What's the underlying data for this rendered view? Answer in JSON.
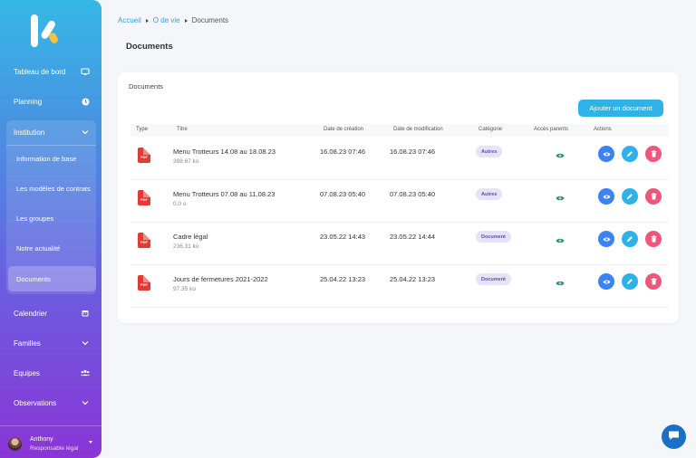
{
  "sidebar": {
    "items_top": [
      {
        "label": "Tableau de bord",
        "icon": "monitor-icon"
      },
      {
        "label": "Planning",
        "icon": "clock-icon"
      }
    ],
    "institution": {
      "label": "Institution",
      "sub_items": [
        {
          "label": "Information de base"
        },
        {
          "label": "Les modèles de contrats"
        },
        {
          "label": "Les groupes"
        },
        {
          "label": "Notre actualité"
        },
        {
          "label": "Documents",
          "active": true
        }
      ]
    },
    "items_bottom": [
      {
        "label": "Calendrier",
        "icon": "calendar-icon"
      },
      {
        "label": "Familles",
        "icon": "chevron-down-icon"
      },
      {
        "label": "Equipes",
        "icon": "users-icon"
      },
      {
        "label": "Observations",
        "icon": "chevron-down-icon"
      }
    ],
    "user": {
      "name": "Anthony",
      "role": "Responsable légal"
    }
  },
  "breadcrumb": {
    "home": "Accueil",
    "parent": "O de vie",
    "current": "Documents"
  },
  "page_title": "Documents",
  "card": {
    "title": "Documents",
    "add_button": "Ajouter un document",
    "columns": [
      "Type",
      "Titre",
      "Date de création",
      "Date de modification",
      "Catégorie",
      "Accès parents",
      "Actions"
    ],
    "rows": [
      {
        "type": "PDF",
        "title": "Menu Trotteurs 14.08 au 18.08.23",
        "size": "398.67 ko",
        "created": "16.08.23 07:46",
        "modified": "16.08.23 07:46",
        "category": "Autres"
      },
      {
        "type": "PDF",
        "title": "Menu Trotteurs 07.08 au 11.08.23",
        "size": "0.0 o",
        "created": "07.08.23 05:40",
        "modified": "07.08.23 05:40",
        "category": "Autres"
      },
      {
        "type": "PDF",
        "title": "Cadre légal",
        "size": "236.31 ko",
        "created": "23.05.22 14:43",
        "modified": "23.05.22 14:44",
        "category": "Document"
      },
      {
        "type": "PDF",
        "title": "Jours de fermetures 2021-2022",
        "size": "97.35 ko",
        "created": "25.04.22 13:23",
        "modified": "25.04.22 13:23",
        "category": "Document"
      }
    ]
  },
  "colors": {
    "accent": "#2fb2e7",
    "view": "#3b82f6",
    "delete": "#f0567a",
    "eye": "#2a8a6a",
    "pdf": "#e53935"
  }
}
